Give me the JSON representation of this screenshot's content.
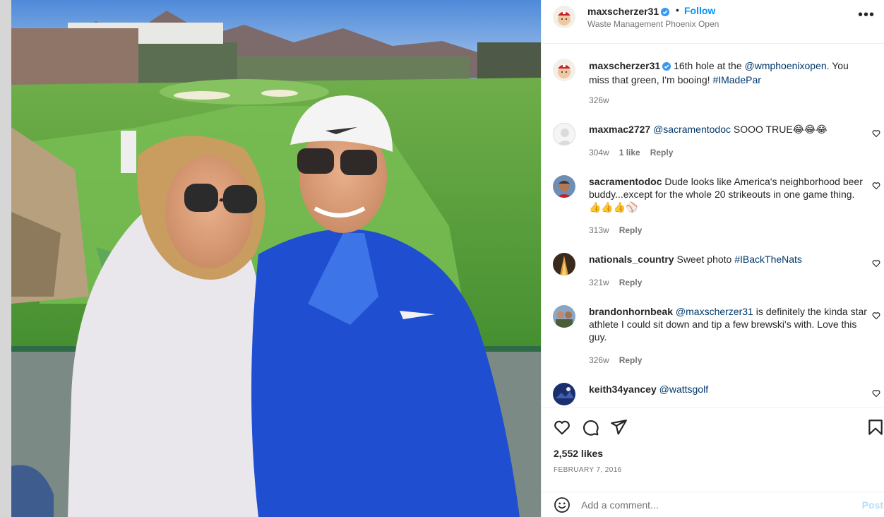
{
  "post": {
    "author": "maxscherzer31",
    "follow_label": "Follow",
    "separator": "•",
    "location": "Waste Management Phoenix Open",
    "more_label": "•••"
  },
  "caption": {
    "username": "maxscherzer31",
    "text_before": " 16th hole at the ",
    "mention": "@wmphoenixopen",
    "text_middle": ". You miss that green, I'm booing! ",
    "hashtag": "#IMadePar",
    "time": "326w"
  },
  "comments": [
    {
      "username": "maxmac2727",
      "mention": "@sacramentodoc",
      "text": " SOOO TRUE😂😂😂",
      "time": "304w",
      "likes": "1 like",
      "reply": "Reply"
    },
    {
      "username": "sacramentodoc",
      "text": " Dude looks like America's neighborhood beer buddy...except for the whole 20 strikeouts in one game thing. 👍👍👍⚾",
      "time": "313w",
      "reply": "Reply"
    },
    {
      "username": "nationals_country",
      "text": " Sweet photo ",
      "hashtag": "#IBackTheNats",
      "time": "321w",
      "reply": "Reply"
    },
    {
      "username": "brandonhornbeak",
      "mention": "@maxscherzer31",
      "text": " is definitely the kinda star athlete I could sit down and tip a few brewski's with. Love this guy.",
      "time": "326w",
      "reply": "Reply"
    },
    {
      "username": "keith34yancey",
      "mention": "@wattsgolf"
    }
  ],
  "stats": {
    "likes": "2,552 likes",
    "date": "FEBRUARY 7, 2016"
  },
  "composer": {
    "placeholder": "Add a comment...",
    "post_label": "Post"
  },
  "icons": {
    "like": "heart-icon",
    "comment": "comment-icon",
    "share": "share-icon",
    "save": "bookmark-icon",
    "emoji": "emoji-icon",
    "more": "more-icon",
    "verified": "verified-badge-icon"
  },
  "colors": {
    "link": "#00376b",
    "follow": "#0095f6",
    "verified": "#3897f0",
    "post_disabled": "#b2dffc",
    "meta": "#737373"
  }
}
